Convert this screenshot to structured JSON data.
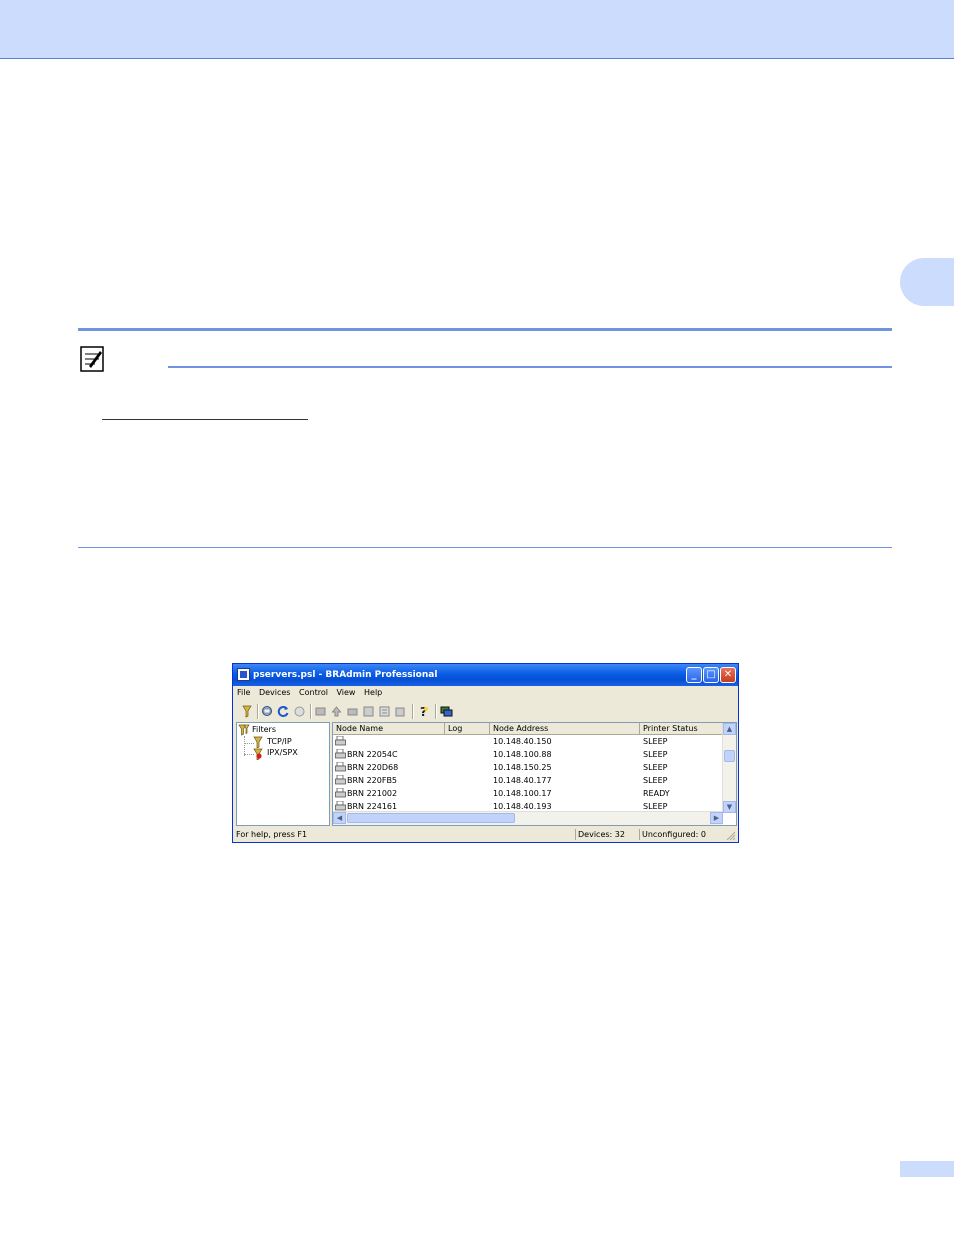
{
  "document": {
    "side_tab_label": "",
    "page_number": ""
  },
  "window": {
    "title": "pservers.psl - BRAdmin Professional",
    "controls": {
      "minimize": "_",
      "maximize": "□",
      "close": "✕"
    },
    "menu": [
      "File",
      "Devices",
      "Control",
      "View",
      "Help"
    ],
    "toolbar_icons": [
      "filter-icon",
      "search-devices-icon",
      "refresh-icon",
      "stop-icon",
      "configure-icon",
      "upgrade-icon",
      "reset-icon",
      "load-icon",
      "properties-icon",
      "export-icon",
      "help-icon",
      "network-icon"
    ],
    "tree": {
      "root": "Filters",
      "children": [
        "TCP/IP",
        "IPX/SPX"
      ]
    },
    "list": {
      "columns": [
        "Node Name",
        "Log",
        "Node Address",
        "Printer Status"
      ],
      "rows": [
        {
          "node_name": "",
          "log": "",
          "node_address": "10.148.40.150",
          "status": "SLEEP"
        },
        {
          "node_name": "BRN 22054C",
          "log": "",
          "node_address": "10.148.100.88",
          "status": "SLEEP"
        },
        {
          "node_name": "BRN 220D68",
          "log": "",
          "node_address": "10.148.150.25",
          "status": "SLEEP"
        },
        {
          "node_name": "BRN 220FB5",
          "log": "",
          "node_address": "10.148.40.177",
          "status": "SLEEP"
        },
        {
          "node_name": "BRN 221002",
          "log": "",
          "node_address": "10.148.100.17",
          "status": "READY"
        },
        {
          "node_name": "BRN 224161",
          "log": "",
          "node_address": "10.148.40.193",
          "status": "SLEEP"
        }
      ]
    },
    "status": {
      "help": "For help, press F1",
      "devices": "Devices: 32",
      "unconfigured": "Unconfigured: 0"
    }
  }
}
